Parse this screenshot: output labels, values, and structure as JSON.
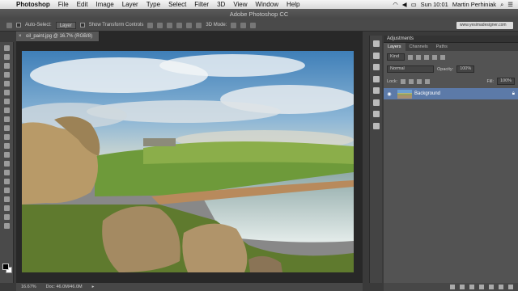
{
  "menubar": {
    "app": "Photoshop",
    "items": [
      "File",
      "Edit",
      "Image",
      "Layer",
      "Type",
      "Select",
      "Filter",
      "3D",
      "View",
      "Window",
      "Help"
    ],
    "clock": "Sun 10:01",
    "user": "Martin Perhiniak"
  },
  "window_title": "Adobe Photoshop CC",
  "options": {
    "auto_select_label": "Auto-Select:",
    "auto_select_value": "Layer",
    "transform_label": "Show Transform Controls",
    "mode_3d": "3D Mode:",
    "website": "www.yesimadesigner.com"
  },
  "document": {
    "tab_title": "oil_paint.jpg @ 16.7% (RGB/8)",
    "zoom": "16.67%",
    "doc_size": "Doc: 46.0M/46.0M"
  },
  "panels": {
    "adjustments_header": "Adjustments",
    "tabs": [
      "Layers",
      "Channels",
      "Paths"
    ],
    "kind_label": "Kind",
    "blend_mode": "Normal",
    "opacity_label": "Opacity:",
    "opacity_value": "100%",
    "lock_label": "Lock:",
    "fill_label": "Fill:",
    "fill_value": "100%",
    "layer_name": "Background"
  }
}
